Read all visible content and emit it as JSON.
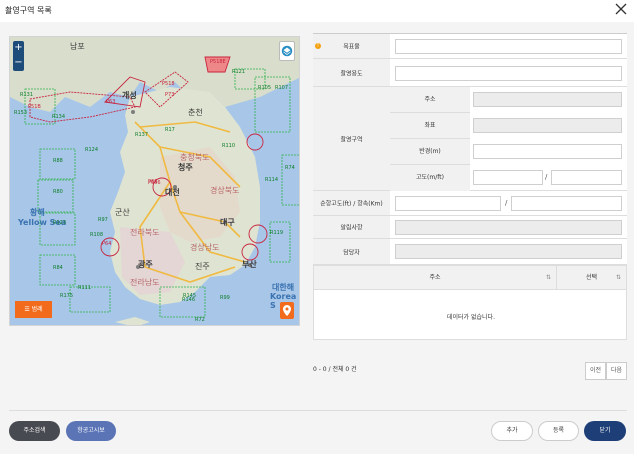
{
  "window": {
    "title": "촬영구역 목록"
  },
  "map": {
    "zoom_in": "+",
    "zoom_out": "−",
    "legend_button": "범례",
    "places": [
      {
        "name": "남포"
      },
      {
        "name": "개성"
      },
      {
        "name": "춘천"
      },
      {
        "name": "청주"
      },
      {
        "name": "대전"
      },
      {
        "name": "경상북도"
      },
      {
        "name": "대구"
      },
      {
        "name": "광주"
      },
      {
        "name": "진주"
      },
      {
        "name": "부산"
      },
      {
        "name": "전라남도"
      },
      {
        "name": "경상남도"
      },
      {
        "name": "군산"
      },
      {
        "name": "충청북도"
      },
      {
        "name": "전라북도"
      }
    ],
    "seas": [
      {
        "name": "황해"
      },
      {
        "name": "Yellow Sea"
      },
      {
        "name": "대한해"
      },
      {
        "name": "Korea S"
      }
    ],
    "zones_green": [
      "R131",
      "R153",
      "R134",
      "R124",
      "R88",
      "R80",
      "R123",
      "R84",
      "R111",
      "R175",
      "R121",
      "R105",
      "R107",
      "R110",
      "R74",
      "R119",
      "R146",
      "R99",
      "R97",
      "R17",
      "R137",
      "R108",
      "R145",
      "R72",
      "R114"
    ],
    "zones_red": [
      "P518",
      "P73",
      "P518E",
      "P65",
      "P63",
      "P51B",
      "P656",
      "P64"
    ]
  },
  "form": {
    "fields": [
      {
        "label": "목표물",
        "required": true,
        "value": ""
      },
      {
        "label": "촬영용도",
        "value": ""
      }
    ],
    "area": {
      "label": "촬영구역",
      "sub": [
        {
          "label": "주소",
          "value": ""
        },
        {
          "label": "좌표",
          "value": ""
        },
        {
          "label": "반경(m)",
          "value": ""
        },
        {
          "label": "고도(m/ft)",
          "value_m": "",
          "sep": "/",
          "value_ft": ""
        }
      ]
    },
    "cruise": {
      "label": "순항고도(ft) / 항속(Km)",
      "sep": "/",
      "value_ft": "",
      "value_km": ""
    },
    "notice": {
      "label": "알림사항",
      "value": ""
    },
    "manager": {
      "label": "담당자",
      "value": ""
    }
  },
  "table": {
    "columns": [
      "주소",
      "선택"
    ],
    "empty": "데이터가 없습니다."
  },
  "pager": {
    "summary": "0 - 0 / 전체 0 건",
    "prev": "이전",
    "next": "다음"
  },
  "footer": {
    "address_search": "주소검색",
    "aviation_notice": "항공고시보",
    "add": "추가",
    "register": "등록",
    "close": "닫기"
  },
  "colors": {
    "accent_orange": "#f26a1b",
    "navy": "#1d3e76",
    "blue": "#5a74b6",
    "zone_green": "#2fb24a",
    "zone_red": "#c8233d"
  }
}
